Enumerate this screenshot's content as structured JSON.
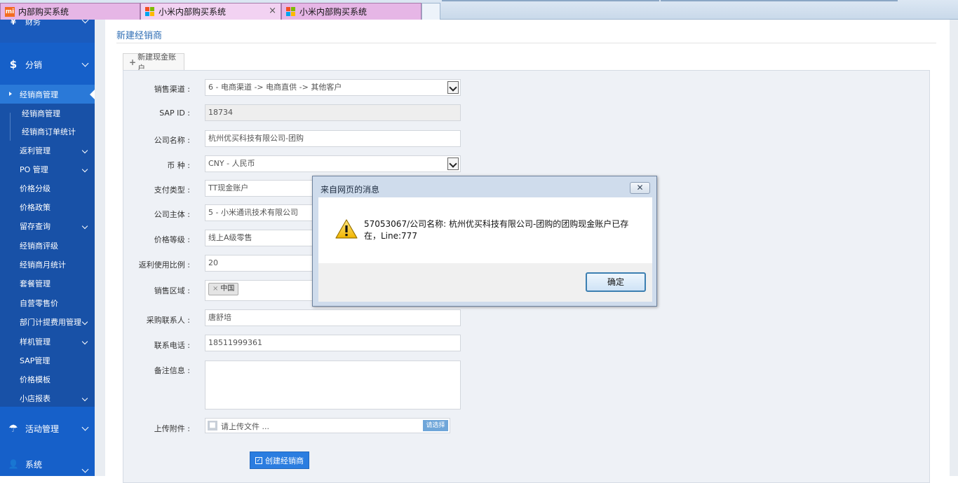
{
  "browser": {
    "tabs": [
      {
        "label": "内部购买系统",
        "icon": "mi-logo-icon"
      },
      {
        "label": "小米内部购买系统",
        "icon": "windows-logo-icon",
        "close": "×"
      },
      {
        "label": "小米内部购买系统",
        "icon": "windows-logo-icon"
      }
    ]
  },
  "sidebar": {
    "finance": {
      "icon": "¥",
      "label": "财务"
    },
    "distribution": {
      "icon": "$",
      "label": "分销"
    },
    "items": [
      {
        "label": "经销商管理"
      },
      {
        "label": "经销商管理"
      },
      {
        "label": "经销商订单统计"
      },
      {
        "label": "返利管理"
      },
      {
        "label": "PO 管理"
      },
      {
        "label": "价格分级"
      },
      {
        "label": "价格政策"
      },
      {
        "label": "留存查询"
      },
      {
        "label": "经销商评级"
      },
      {
        "label": "经销商月统计"
      },
      {
        "label": "套餐管理"
      },
      {
        "label": "自营零售价"
      },
      {
        "label": "部门计提费用管理"
      },
      {
        "label": "样机管理"
      },
      {
        "label": "SAP管理"
      },
      {
        "label": "价格模板"
      },
      {
        "label": "小店报表"
      }
    ],
    "activity": {
      "icon": "☂",
      "label": "活动管理"
    },
    "system": {
      "icon": "👤",
      "label": "系统"
    }
  },
  "page": {
    "title": "新建经销商",
    "tab_label": "新建现金账户",
    "tab_icon": "+"
  },
  "form": {
    "channel": {
      "label": "销售渠道 :",
      "value": "6 - 电商渠道 -> 电商直供 -> 其他客户"
    },
    "sap_id": {
      "label": "SAP ID :",
      "value": "18734"
    },
    "company_name": {
      "label": "公司名称 :",
      "value": "杭州优买科技有限公司-团购"
    },
    "currency": {
      "label": "币 种 :",
      "value": "CNY - 人民币"
    },
    "payment_type": {
      "label": "支付类型 :",
      "value": "TT现金账户"
    },
    "company_entity": {
      "label": "公司主体 :",
      "value": "5 - 小米通讯技术有限公司"
    },
    "price_level": {
      "label": "价格等级 :",
      "value": "线上A级零售"
    },
    "rebate_ratio": {
      "label": "返利使用比例 :",
      "value": "20"
    },
    "sales_region": {
      "label": "销售区域 :",
      "tag": "中国",
      "tag_remove": "×"
    },
    "contact": {
      "label": "采购联系人 :",
      "value": "唐舒培"
    },
    "phone": {
      "label": "联系电话 :",
      "value": "18511999361"
    },
    "remarks": {
      "label": "备注信息 :",
      "value": ""
    },
    "attachment": {
      "label": "上传附件 :",
      "placeholder": "请上传文件 ...",
      "button": "请选择"
    },
    "submit": {
      "label": "创建经销商",
      "icon": "✓"
    }
  },
  "dialog": {
    "title": "来自网页的消息",
    "close": "✕",
    "message": "57053067/公司名称: 杭州优买科技有限公司-团购的团购现金账户已存在，Line:777",
    "ok": "确定"
  },
  "colors": {
    "sidebar_bg": "#1851a7",
    "sidebar_active": "#2a79d8",
    "accent": "#2b7de0",
    "tab_bg": "#e6b6e6"
  }
}
